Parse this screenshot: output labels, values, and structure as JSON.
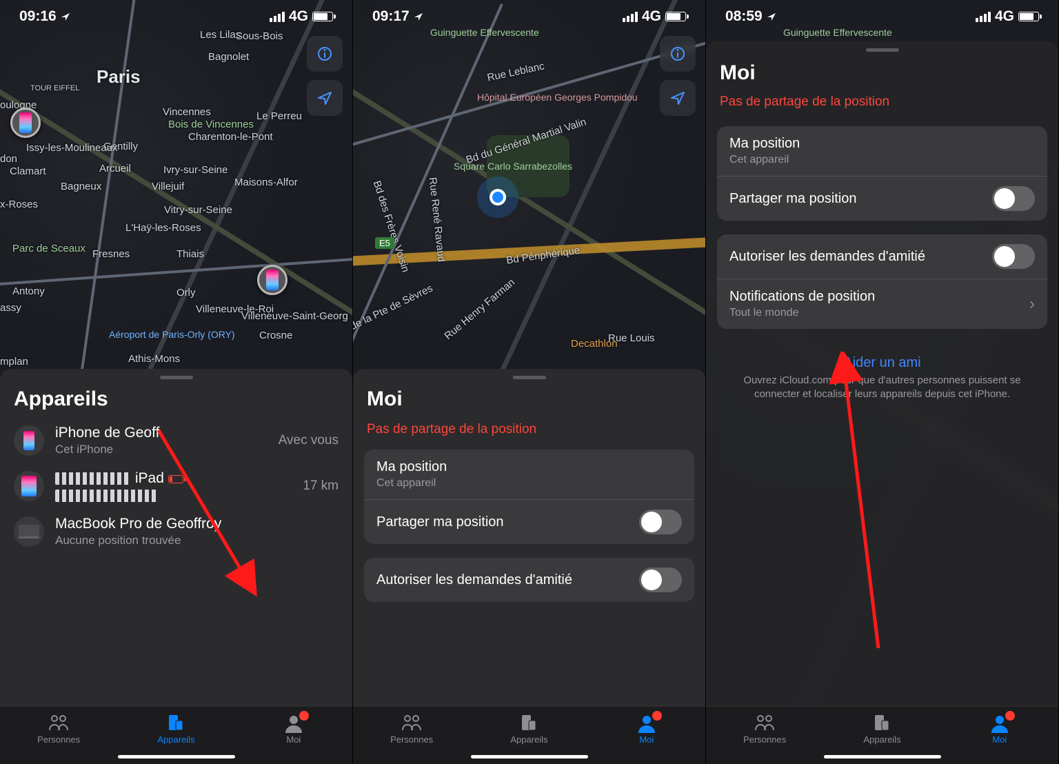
{
  "screens": [
    {
      "status": {
        "time": "09:16",
        "network": "4G"
      },
      "map": {
        "city_label": "Paris",
        "places": [
          "Les Lilas",
          "Bagnolet",
          "Vincennes",
          "Charenton-le-Pont",
          "Le Perreu",
          "Sous-Bois",
          "Ivry-sur-Seine",
          "Maisons-Alfor",
          "Vitry-sur-Seine",
          "Gentilly",
          "Arcueil",
          "Villejuif",
          "Bagneux",
          "Clamart",
          "L'Haÿ-les-Roses",
          "Fresnes",
          "Thiais",
          "Orly",
          "Athis-Mons",
          "Crosne",
          "Villeneuve-le-Roi",
          "Villeneuve-Saint-Georg",
          "Antony",
          "Issy-les-Moulineaux",
          "Parc de Sceaux",
          "Bois de Vincennes",
          "TOUR EIFFEL",
          "Aéroport de Paris-Orly (ORY)",
          "x-Roses",
          "don",
          "mplan",
          "assy",
          "oulogne"
        ]
      },
      "panel": {
        "title": "Appareils",
        "rows": [
          {
            "name": "iPhone de Geoff",
            "sub": "Cet iPhone",
            "meta": "Avec vous"
          },
          {
            "name": "iPad",
            "sub": "",
            "meta": "17 km",
            "low_batt": true,
            "redacted": true
          },
          {
            "name": "MacBook Pro de Geoffroy",
            "sub": "Aucune position trouvée",
            "meta": ""
          }
        ]
      },
      "tabs": {
        "people": "Personnes",
        "devices": "Appareils",
        "me": "Moi",
        "active": "devices",
        "badge_on": "me"
      }
    },
    {
      "status": {
        "time": "09:17",
        "network": "4G"
      },
      "map": {
        "places": [
          "Rue Leblanc",
          "Bd du Général Martial Valin",
          "Bd Périphérique",
          "Rue René Ravaud",
          "Rue Henry Farman",
          "Rue Louis",
          "Bd des Frères Voisin",
          "Av de la Pte de Sèvres"
        ],
        "hospital": "Hôpital Européen Georges Pompidou",
        "square": "Square Carlo Sarrabezolles",
        "guinguette": "Guinguette Effervescente",
        "decathlon": "Decathlon",
        "highway": "E5"
      },
      "panel": {
        "title": "Moi",
        "warn": "Pas de partage de la position",
        "rows": [
          {
            "primary": "Ma position",
            "secondary": "Cet appareil"
          },
          {
            "primary": "Partager ma position",
            "toggle": false
          }
        ],
        "rows2": [
          {
            "primary": "Autoriser les demandes d'amitié",
            "toggle": false
          }
        ]
      },
      "tabs": {
        "people": "Personnes",
        "devices": "Appareils",
        "me": "Moi",
        "active": "me",
        "badge_on": "me"
      }
    },
    {
      "status": {
        "time": "08:59",
        "network": "4G"
      },
      "map": {
        "guinguette": "Guinguette Effervescente"
      },
      "panel": {
        "title": "Moi",
        "warn": "Pas de partage de la position",
        "rows": [
          {
            "primary": "Ma position",
            "secondary": "Cet appareil"
          },
          {
            "primary": "Partager ma position",
            "toggle": false
          }
        ],
        "rows2": [
          {
            "primary": "Autoriser les demandes d'amitié",
            "toggle": false
          },
          {
            "primary": "Notifications de position",
            "secondary": "Tout le monde",
            "chevron": true
          }
        ],
        "help": {
          "link": "Aider un ami",
          "sub": "Ouvrez iCloud.com pour que d'autres personnes puissent se connecter et localiser leurs appareils depuis cet iPhone."
        }
      },
      "tabs": {
        "people": "Personnes",
        "devices": "Appareils",
        "me": "Moi",
        "active": "me",
        "badge_on": "me"
      }
    }
  ]
}
